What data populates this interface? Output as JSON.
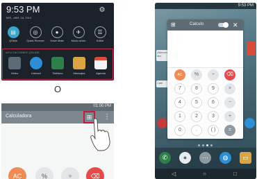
{
  "shade": {
    "time": "9:53 PM",
    "date": "MIÉ., ABR. 18, 2013",
    "quick_settings": [
      {
        "label": "QSlide",
        "icon": "qslide-icon",
        "glyph": "▤",
        "active": true
      },
      {
        "label": "Quick Remote",
        "icon": "remote-icon",
        "glyph": "◎",
        "active": false
      },
      {
        "label": "Voice Mate",
        "icon": "microphone-icon",
        "glyph": "●",
        "active": false
      },
      {
        "label": "Modo avión",
        "icon": "airplane-icon",
        "glyph": "✈",
        "active": false
      },
      {
        "label": "Editar",
        "icon": "list-icon",
        "glyph": "☰",
        "active": false
      }
    ],
    "apps_title": "APLICACIONES QSLIDE",
    "apps": [
      {
        "label": "Video",
        "icon": "video-icon",
        "color": "#5b6b7a"
      },
      {
        "label": "Internet",
        "icon": "globe-icon",
        "color": "#2c8fd6"
      },
      {
        "label": "Teléfono",
        "icon": "phone-icon",
        "color": "#2f7f4a"
      },
      {
        "label": "Mensajes",
        "icon": "message-icon",
        "color": "#d9a441"
      },
      {
        "label": "Agenda",
        "icon": "calendar-icon",
        "color": "#f3f3f3"
      }
    ]
  },
  "separator": "O",
  "calculator_app": {
    "status": "01:00 PM",
    "title": "Calculadora",
    "slide_icon": "⊞",
    "menu_icon": "⋮",
    "keys": [
      {
        "label": "AC",
        "bg": "#f08b55",
        "fg": "#ffffff"
      },
      {
        "label": "%",
        "bg": "#e3e6e8",
        "fg": "#555555"
      },
      {
        "label": "÷",
        "bg": "#e3e6e8",
        "fg": "#555555"
      },
      {
        "label": "⌫",
        "bg": "#e64a4a",
        "fg": "#ffffff"
      }
    ]
  },
  "phone": {
    "status": "9:53 PM",
    "float_calc": {
      "title": "Calculo",
      "expand_icon": "⊞",
      "close_icon": "✕",
      "rows": [
        [
          "AC",
          "%",
          "÷",
          "⌫"
        ],
        [
          "7",
          "8",
          "9",
          "×"
        ],
        [
          "4",
          "5",
          "6",
          "−"
        ],
        [
          "1",
          "2",
          "3",
          "+"
        ],
        [
          "0",
          ".",
          "( )",
          "="
        ]
      ]
    },
    "widget_a": "¡Bienven ido!",
    "widget_b": "Cale",
    "dock": [
      {
        "icon": "phone-icon",
        "glyph": "✆",
        "color": "#2f7f4a"
      },
      {
        "icon": "contacts-icon",
        "glyph": "●",
        "color": "#e9ecee"
      },
      {
        "icon": "apps-icon",
        "glyph": "⋯",
        "color": "#8d9aa1"
      },
      {
        "icon": "globe-icon",
        "glyph": "◍",
        "color": "#2c8fd6"
      },
      {
        "icon": "message-icon",
        "glyph": "▭",
        "color": "#d9a441"
      }
    ],
    "nav": [
      "◁",
      "○",
      "□"
    ]
  }
}
